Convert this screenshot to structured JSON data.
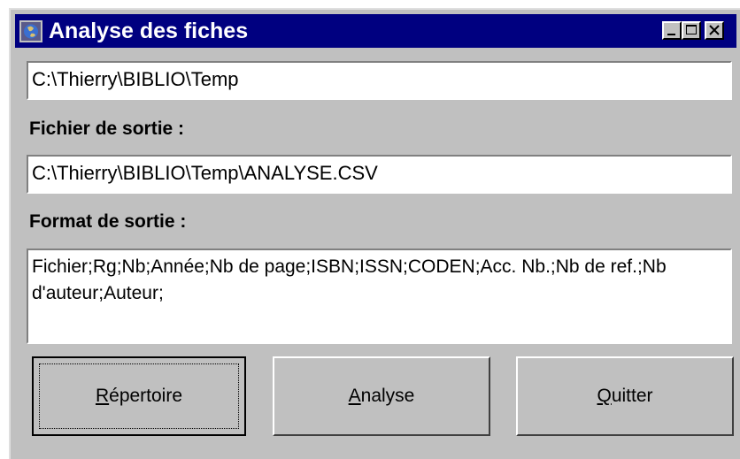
{
  "window": {
    "title": "Analyse des fiches",
    "colors": {
      "titlebar": "#000080",
      "face": "#c0c0c0"
    }
  },
  "directory_field": {
    "value": "C:\\Thierry\\BIBLIO\\Temp"
  },
  "output_file": {
    "label": "Fichier de sortie :",
    "value": "C:\\Thierry\\BIBLIO\\Temp\\ANALYSE.CSV"
  },
  "output_format": {
    "label": "Format de sortie :",
    "value": "Fichier;Rg;Nb;Année;Nb de page;ISBN;ISSN;CODEN;Acc. Nb.;Nb de ref.;Nb d'auteur;Auteur;"
  },
  "buttons": {
    "directory": {
      "mnemonic": "R",
      "rest": "épertoire"
    },
    "analyse": {
      "mnemonic": "A",
      "rest": "nalyse"
    },
    "quit": {
      "mnemonic": "Q",
      "rest": "uitter"
    }
  },
  "icons": [
    "app-globe-icon",
    "minimize-icon",
    "maximize-icon",
    "close-icon"
  ]
}
